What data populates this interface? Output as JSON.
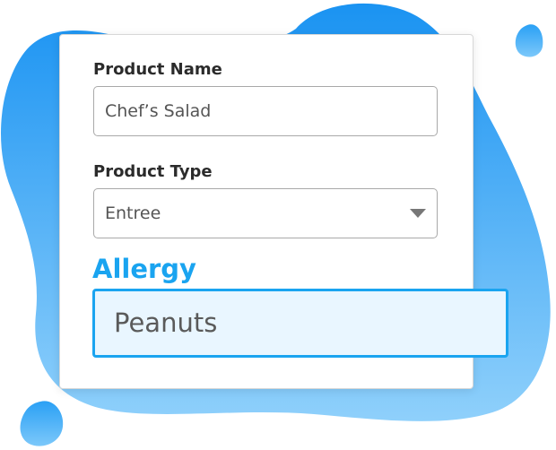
{
  "form": {
    "product_name": {
      "label": "Product Name",
      "value": "Chef’s Salad"
    },
    "product_type": {
      "label": "Product Type",
      "selected": "Entree"
    },
    "allergy": {
      "label": "Allergy",
      "value": "Peanuts"
    }
  },
  "colors": {
    "accent": "#1aa4f0",
    "blob_light": "#8fd0fb",
    "blob_dark": "#2196f3",
    "allergy_field_bg": "#e9f6ff"
  },
  "icons": {
    "dropdown": "caret-down-icon"
  }
}
